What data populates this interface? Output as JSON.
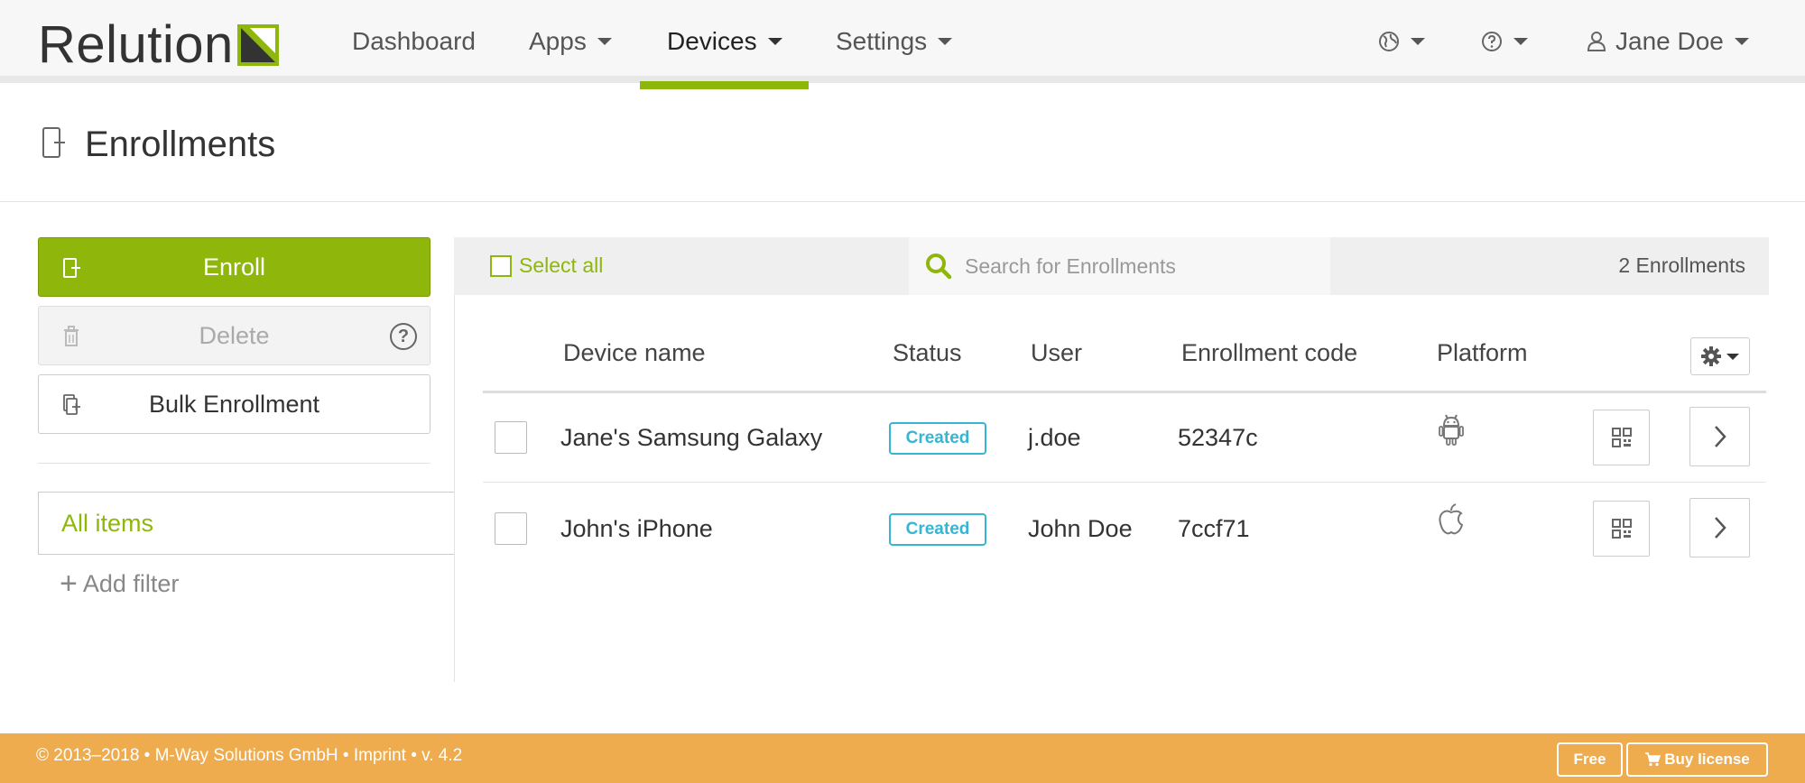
{
  "header": {
    "logo_text": "Relution",
    "nav": [
      {
        "label": "Dashboard"
      },
      {
        "label": "Apps"
      },
      {
        "label": "Devices"
      },
      {
        "label": "Settings"
      }
    ],
    "user_label": "Jane Doe",
    "accent_color": "#8fb70b"
  },
  "page": {
    "title": "Enrollments"
  },
  "sidebar": {
    "enroll_label": "Enroll",
    "delete_label": "Delete",
    "bulk_label": "Bulk Enrollment",
    "help_glyph": "?",
    "filter_all_items": "All items",
    "add_filter_label": "Add filter"
  },
  "toolbar": {
    "select_all_label": "Select all",
    "search_placeholder": "Search for Enrollments",
    "count_label": "2 Enrollments"
  },
  "table": {
    "columns": [
      "Device name",
      "Status",
      "User",
      "Enrollment code",
      "Platform"
    ],
    "rows": [
      {
        "device_name": "Jane's Samsung Galaxy",
        "status": "Created",
        "user": "j.doe",
        "code": "52347c",
        "platform_icon": "android-icon"
      },
      {
        "device_name": "John's iPhone",
        "status": "Created",
        "user": "John Doe",
        "code": "7ccf71",
        "platform_icon": "apple-icon"
      }
    ],
    "status_color": "#36b5d4"
  },
  "footer": {
    "copyright": "© 2013–2018 • M-Way Solutions GmbH • Imprint • v. 4.2",
    "free_label": "Free",
    "buy_label": "Buy license",
    "color": "#efac4e"
  }
}
